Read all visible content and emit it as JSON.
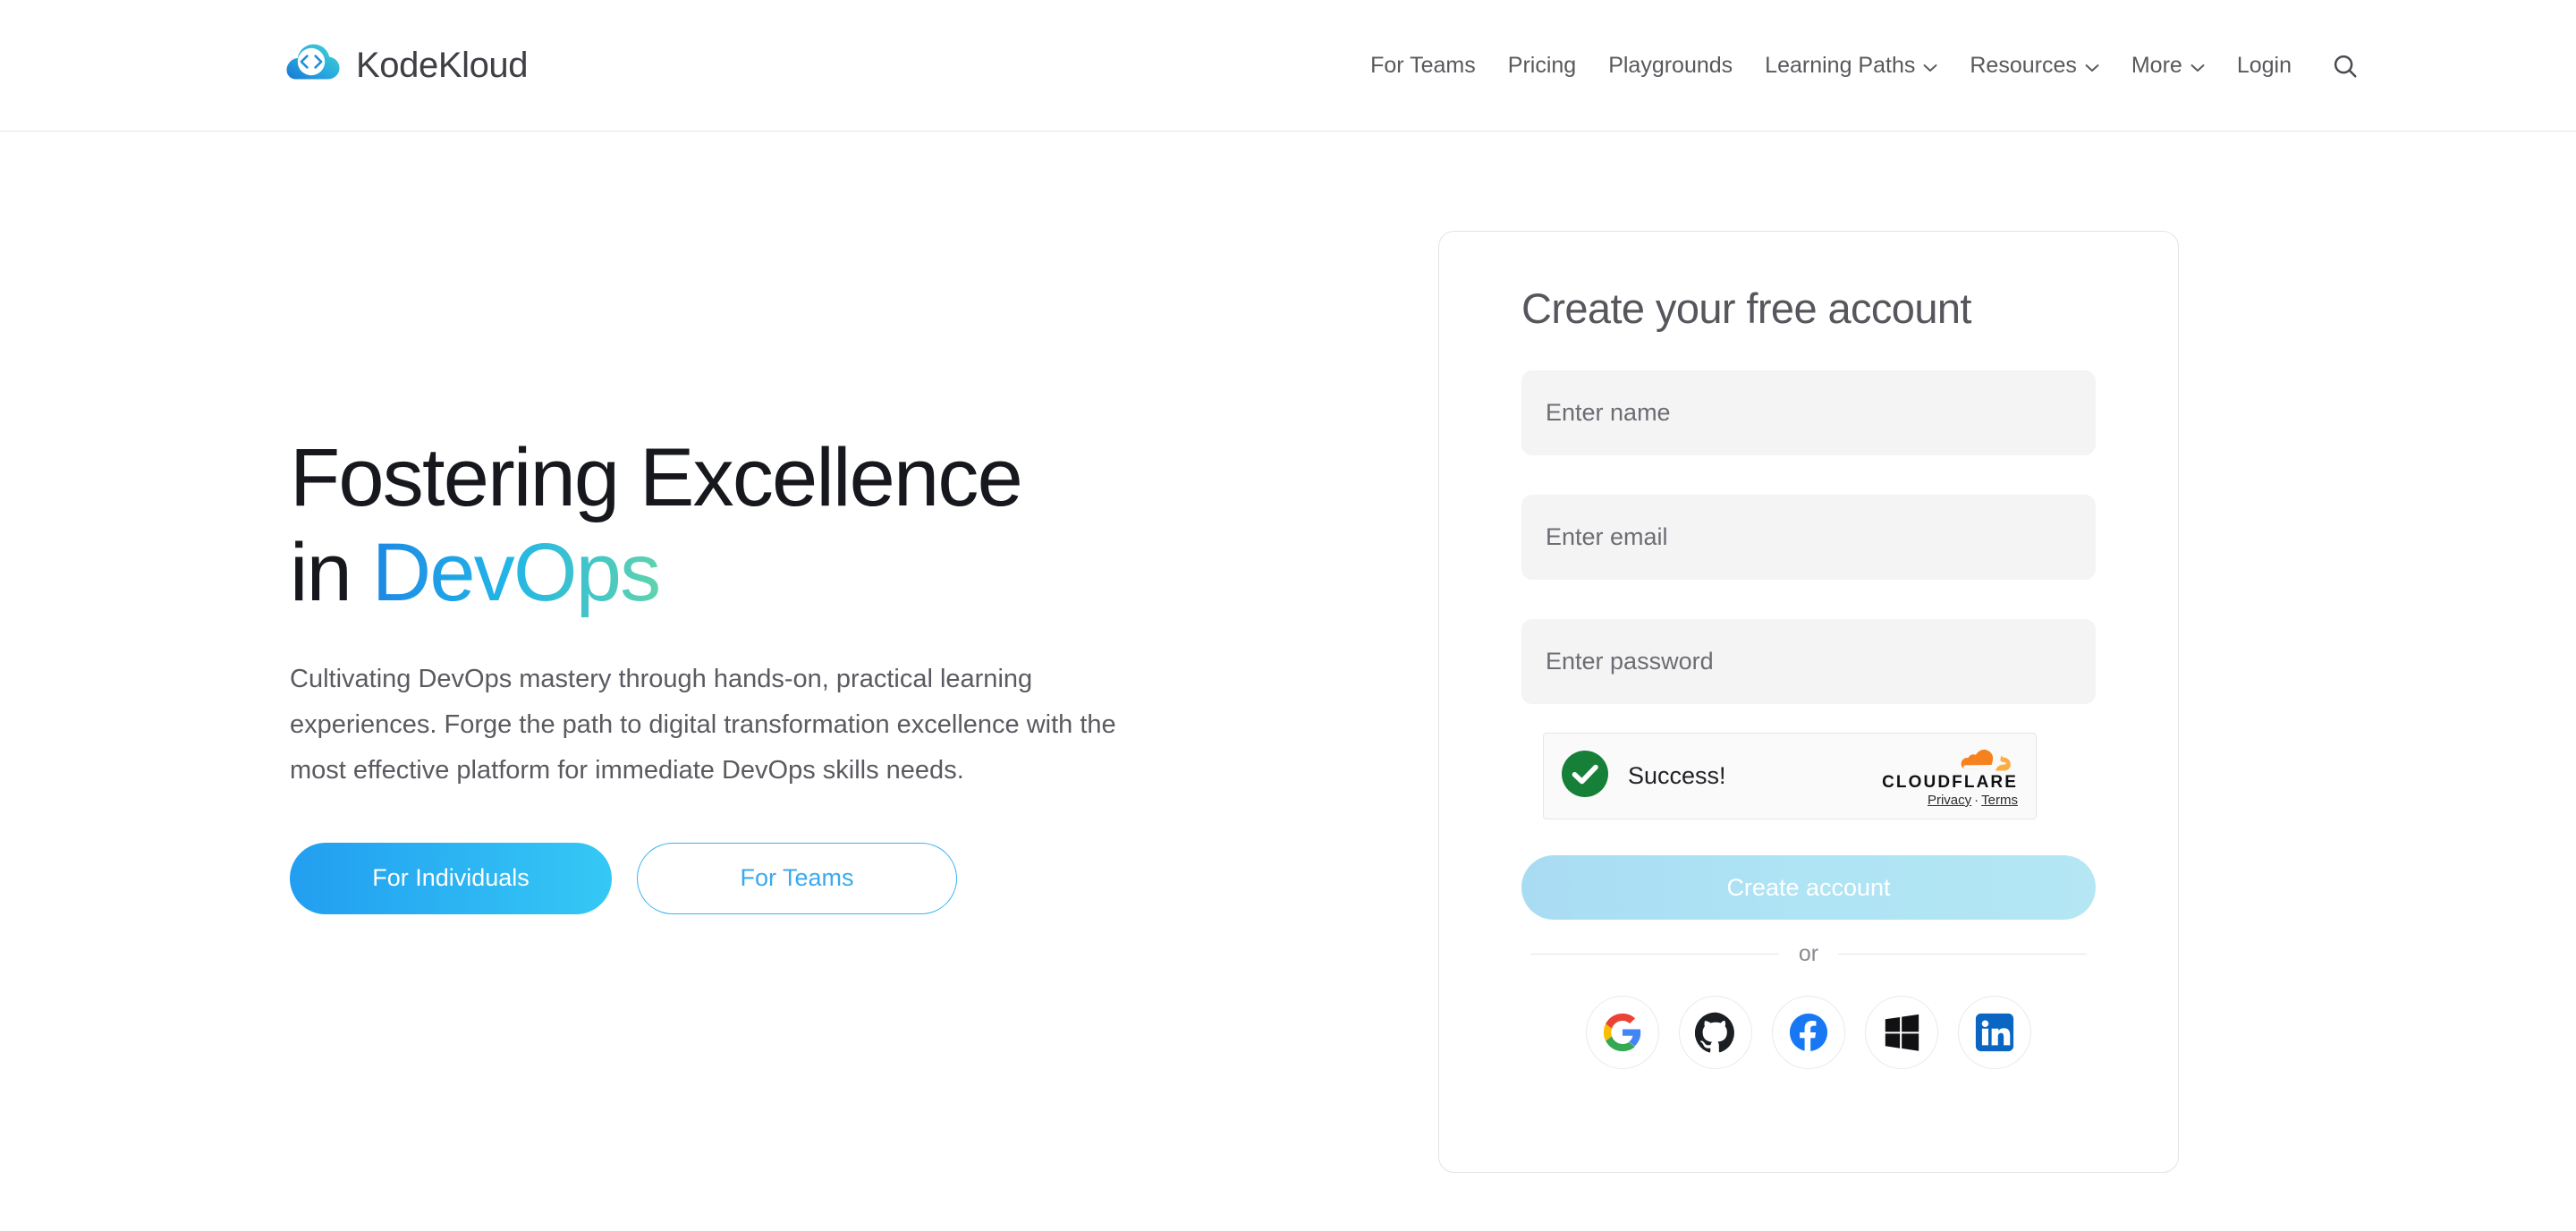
{
  "header": {
    "brand": {
      "name": "KodeKloud",
      "logo_icon": "kodekloud-cloud-code-logo"
    },
    "nav": [
      {
        "label": "For Teams",
        "has_caret": false
      },
      {
        "label": "Pricing",
        "has_caret": false
      },
      {
        "label": "Playgrounds",
        "has_caret": false
      },
      {
        "label": "Learning Paths",
        "has_caret": true
      },
      {
        "label": "Resources",
        "has_caret": true
      },
      {
        "label": "More",
        "has_caret": true
      },
      {
        "label": "Login",
        "has_caret": false
      }
    ],
    "search_icon": "search-icon"
  },
  "hero": {
    "title_line1": "Fostering Excellence",
    "title_line2_prefix": "in ",
    "title_accent": "DevOps",
    "subtitle": "Cultivating DevOps mastery through hands-on, practical learning experiences. Forge the path to digital transformation excellence with the most effective platform for immediate DevOps skills needs.",
    "cta_primary": "For Individuals",
    "cta_secondary": "For Teams"
  },
  "signup": {
    "title": "Create your free account",
    "fields": [
      {
        "name": "name",
        "placeholder": "Enter name",
        "value": "",
        "type": "text"
      },
      {
        "name": "email",
        "placeholder": "Enter email",
        "value": "",
        "type": "email"
      },
      {
        "name": "password",
        "placeholder": "Enter password",
        "value": "",
        "type": "password"
      }
    ],
    "turnstile": {
      "status": "Success!",
      "status_icon": "green-check-circle-icon",
      "brand": "CLOUDFLARE",
      "brand_icon": "cloudflare-cloud-icon",
      "privacy_label": "Privacy",
      "separator": "·",
      "terms_label": "Terms"
    },
    "submit_label": "Create account",
    "divider_label": "or",
    "social_providers": [
      {
        "name": "google",
        "icon": "google-icon"
      },
      {
        "name": "github",
        "icon": "github-icon"
      },
      {
        "name": "facebook",
        "icon": "facebook-icon"
      },
      {
        "name": "microsoft",
        "icon": "microsoft-icon"
      },
      {
        "name": "linkedin",
        "icon": "linkedin-icon"
      }
    ]
  },
  "colors": {
    "accent_blue": "#2196f3",
    "accent_cyan": "#35c8f5",
    "accent_teal": "#5fd3ad",
    "text_dark": "#16181d",
    "text_muted": "#5a5a60",
    "success_green": "#178038",
    "cloudflare_orange": "#f6821f"
  }
}
